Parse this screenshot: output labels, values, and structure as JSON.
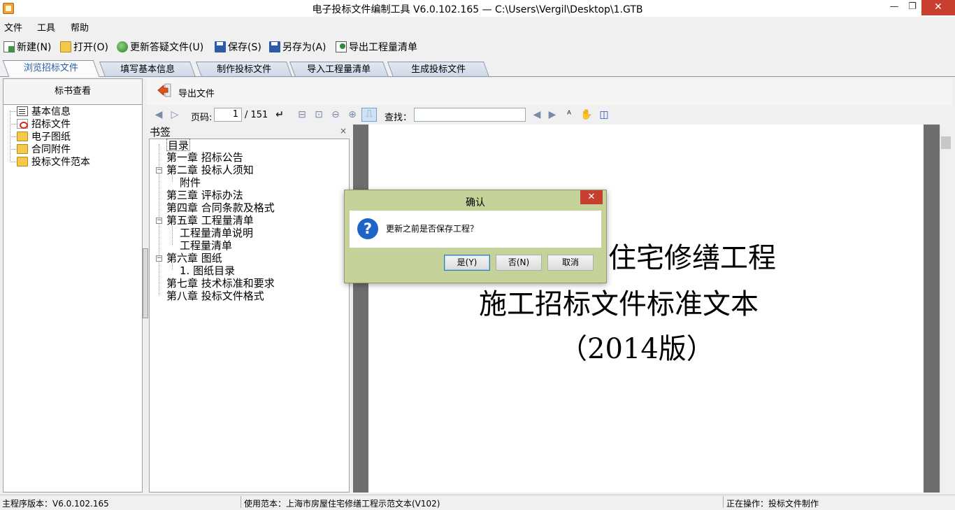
{
  "window": {
    "title": "电子投标文件编制工具 V6.0.102.165 — C:\\Users\\Vergil\\Desktop\\1.GTB",
    "min_icon": "—",
    "max_icon": "❐",
    "close_icon": "✕"
  },
  "menu": [
    "文件",
    "工具",
    "帮助"
  ],
  "toolbar": {
    "new": "新建(N)",
    "open": "打开(O)",
    "update": "更新答疑文件(U)",
    "save": "保存(S)",
    "save_as": "另存为(A)",
    "export": "导出工程量清单"
  },
  "tabs": [
    "浏览招标文件",
    "填写基本信息",
    "制作投标文件",
    "导入工程量清单",
    "生成投标文件"
  ],
  "left_panel": {
    "header": "标书查看",
    "items": [
      "基本信息",
      "招标文件",
      "电子图纸",
      "合同附件",
      "投标文件范本"
    ]
  },
  "export_bar": {
    "label": "导出文件"
  },
  "viewer": {
    "page_label": "页码:",
    "page_current": "1",
    "page_total": "/ 151",
    "find_label": "查找："
  },
  "bookmarks": {
    "title": "书签",
    "close": "×",
    "items": [
      "目录",
      "第一章  招标公告",
      "第二章  投标人须知",
      "附件",
      "第三章  评标办法",
      "第四章  合同条款及格式",
      "第五章  工程量清单",
      "工程量清单说明",
      "工程量清单",
      "第六章  图纸",
      "1. 图纸目录",
      "第七章  技术标准和要求",
      "第八章  投标文件格式"
    ]
  },
  "document": {
    "line1": "屋住宅修缮工程",
    "line2": "施工招标文件标准文本",
    "line3": "（2014版）"
  },
  "status": {
    "version": "主程序版本：V6.0.102.165",
    "template": "使用范本：上海市房屋住宅修缮工程示范文本(V102)",
    "operation": "正在操作：投标文件制作"
  },
  "dialog": {
    "title": "确认",
    "close": "✕",
    "icon": "?",
    "message": "更新之前是否保存工程？",
    "yes": "是(Y)",
    "no": "否(N)",
    "cancel": "取消"
  },
  "colors": {
    "dialog_frame": "#c5d39a",
    "close_red": "#c7402f",
    "question_blue": "#1f63c9",
    "active_tab_text": "#2a5ea6"
  }
}
